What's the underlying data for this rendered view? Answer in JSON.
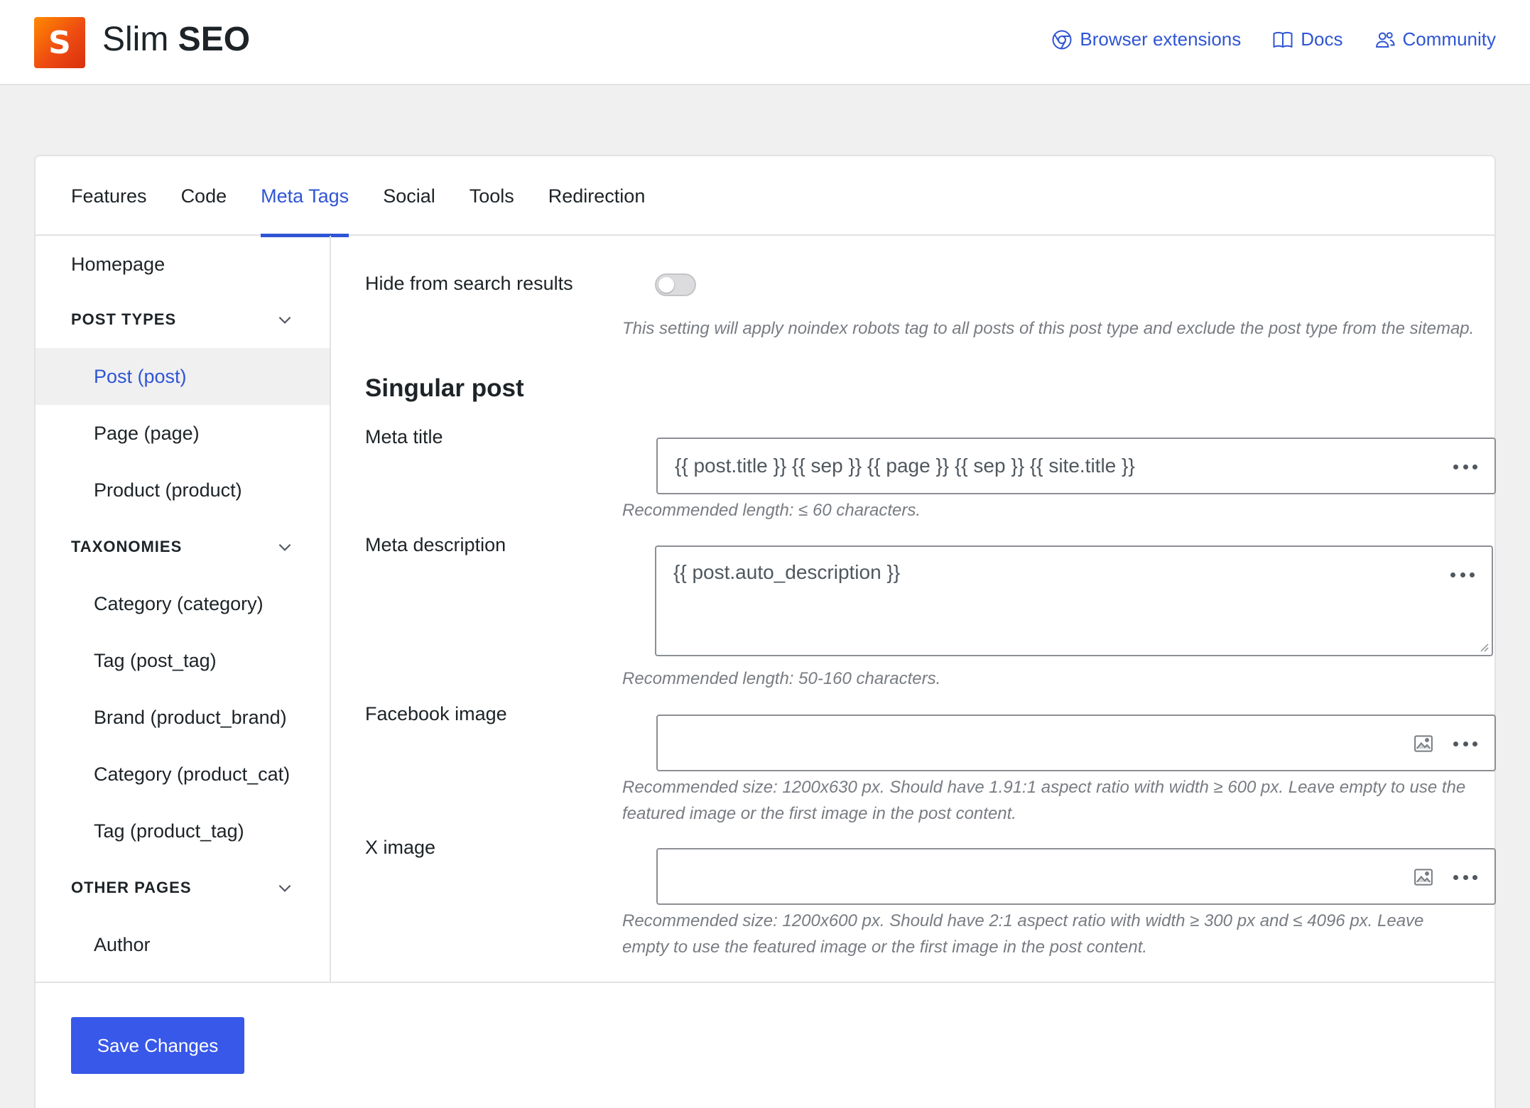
{
  "header": {
    "logo_letter": "S",
    "brand_thin": "Slim",
    "brand_bold": "SEO",
    "links": [
      {
        "label": "Browser extensions",
        "icon": "chrome-icon"
      },
      {
        "label": "Docs",
        "icon": "book-icon"
      },
      {
        "label": "Community",
        "icon": "users-icon"
      }
    ]
  },
  "tabs": [
    {
      "label": "Features",
      "active": false
    },
    {
      "label": "Code",
      "active": false
    },
    {
      "label": "Meta Tags",
      "active": true
    },
    {
      "label": "Social",
      "active": false
    },
    {
      "label": "Tools",
      "active": false
    },
    {
      "label": "Redirection",
      "active": false
    }
  ],
  "sidebar": {
    "homepage": "Homepage",
    "post_types": {
      "heading": "POST TYPES",
      "items": [
        "Post (post)",
        "Page (page)",
        "Product (product)"
      ],
      "active_index": 0
    },
    "taxonomies": {
      "heading": "TAXONOMIES",
      "items": [
        "Category (category)",
        "Tag (post_tag)",
        "Brand (product_brand)",
        "Category (product_cat)",
        "Tag (product_tag)"
      ]
    },
    "other_pages": {
      "heading": "OTHER PAGES",
      "items": [
        "Author"
      ]
    }
  },
  "main": {
    "hide_search": {
      "label": "Hide from search results",
      "enabled": false,
      "help": "This setting will apply noindex robots tag to all posts of this post type and exclude the post type from the sitemap."
    },
    "section_title": "Singular post",
    "meta_title": {
      "label": "Meta title",
      "value": "{{ post.title }} {{ sep }} {{ page }} {{ sep }} {{ site.title }}",
      "help": "Recommended length: ≤ 60 characters."
    },
    "meta_description": {
      "label": "Meta description",
      "value": "{{ post.auto_description }}",
      "help": "Recommended length: 50-160 characters."
    },
    "facebook_image": {
      "label": "Facebook image",
      "value": "",
      "help": "Recommended size: 1200x630 px. Should have 1.91:1 aspect ratio with width ≥ 600 px. Leave empty to use the featured image or the first image in the post content."
    },
    "x_image": {
      "label": "X image",
      "value": "",
      "help": "Recommended size: 1200x600 px. Should have 2:1 aspect ratio with width ≥ 300 px and ≤ 4096 px. Leave empty to use the featured image or the first image in the post content."
    }
  },
  "footer": {
    "save_label": "Save Changes"
  },
  "colors": {
    "accent": "#2f55d4",
    "button": "#3858e9",
    "logo_gradient_start": "#ff8a00",
    "logo_gradient_end": "#d8300e"
  }
}
